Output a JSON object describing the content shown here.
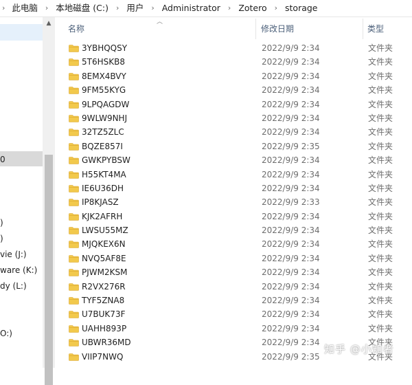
{
  "breadcrumb": {
    "segments": [
      "此电脑",
      "本地磁盘 (C:)",
      "用户",
      "Administrator",
      "Zotero",
      "storage"
    ]
  },
  "nav": {
    "items": [
      "0",
      ")",
      ")",
      "vie (J:)",
      "ware (K:)",
      "dy (L:)",
      "O:)"
    ]
  },
  "columns": {
    "name": "名称",
    "date": "修改日期",
    "type": "类型"
  },
  "rows": [
    {
      "name": "3YBHQQSY",
      "date": "2022/9/9 2:34",
      "type": "文件夹"
    },
    {
      "name": "5T6HSKB8",
      "date": "2022/9/9 2:34",
      "type": "文件夹"
    },
    {
      "name": "8EMX4BVY",
      "date": "2022/9/9 2:34",
      "type": "文件夹"
    },
    {
      "name": "9FM55KYG",
      "date": "2022/9/9 2:34",
      "type": "文件夹"
    },
    {
      "name": "9LPQAGDW",
      "date": "2022/9/9 2:34",
      "type": "文件夹"
    },
    {
      "name": "9WLW9NHJ",
      "date": "2022/9/9 2:34",
      "type": "文件夹"
    },
    {
      "name": "32TZ5ZLC",
      "date": "2022/9/9 2:34",
      "type": "文件夹"
    },
    {
      "name": "BQZE857I",
      "date": "2022/9/9 2:35",
      "type": "文件夹"
    },
    {
      "name": "GWKPYBSW",
      "date": "2022/9/9 2:34",
      "type": "文件夹"
    },
    {
      "name": "H55KT4MA",
      "date": "2022/9/9 2:34",
      "type": "文件夹"
    },
    {
      "name": "IE6U36DH",
      "date": "2022/9/9 2:34",
      "type": "文件夹"
    },
    {
      "name": "IP8KJASZ",
      "date": "2022/9/9 2:33",
      "type": "文件夹"
    },
    {
      "name": "KJK2AFRH",
      "date": "2022/9/9 2:34",
      "type": "文件夹"
    },
    {
      "name": "LWSU55MZ",
      "date": "2022/9/9 2:34",
      "type": "文件夹"
    },
    {
      "name": "MJQKEX6N",
      "date": "2022/9/9 2:34",
      "type": "文件夹"
    },
    {
      "name": "NVQ5AF8E",
      "date": "2022/9/9 2:34",
      "type": "文件夹"
    },
    {
      "name": "PJWM2KSM",
      "date": "2022/9/9 2:34",
      "type": "文件夹"
    },
    {
      "name": "R2VX276R",
      "date": "2022/9/9 2:34",
      "type": "文件夹"
    },
    {
      "name": "TYF5ZNA8",
      "date": "2022/9/9 2:34",
      "type": "文件夹"
    },
    {
      "name": "U7BUK73F",
      "date": "2022/9/9 2:34",
      "type": "文件夹"
    },
    {
      "name": "UAHH893P",
      "date": "2022/9/9 2:34",
      "type": "文件夹"
    },
    {
      "name": "UBWR36MD",
      "date": "2022/9/9 2:34",
      "type": "文件夹"
    },
    {
      "name": "VIIP7NWQ",
      "date": "2022/9/9 2:35",
      "type": "文件夹"
    }
  ],
  "watermark": "知乎 @小知者",
  "icons": {
    "separator": "chevron-right-icon",
    "folder": "folder-icon",
    "sort": "sort-ascending-icon",
    "scroll_up": "scroll-up-arrow-icon"
  },
  "colors": {
    "folder": "#f2c94c",
    "folder_dark": "#d9a62e",
    "nav_selected": "#d9d9d9",
    "header_text": "#4c607a"
  }
}
